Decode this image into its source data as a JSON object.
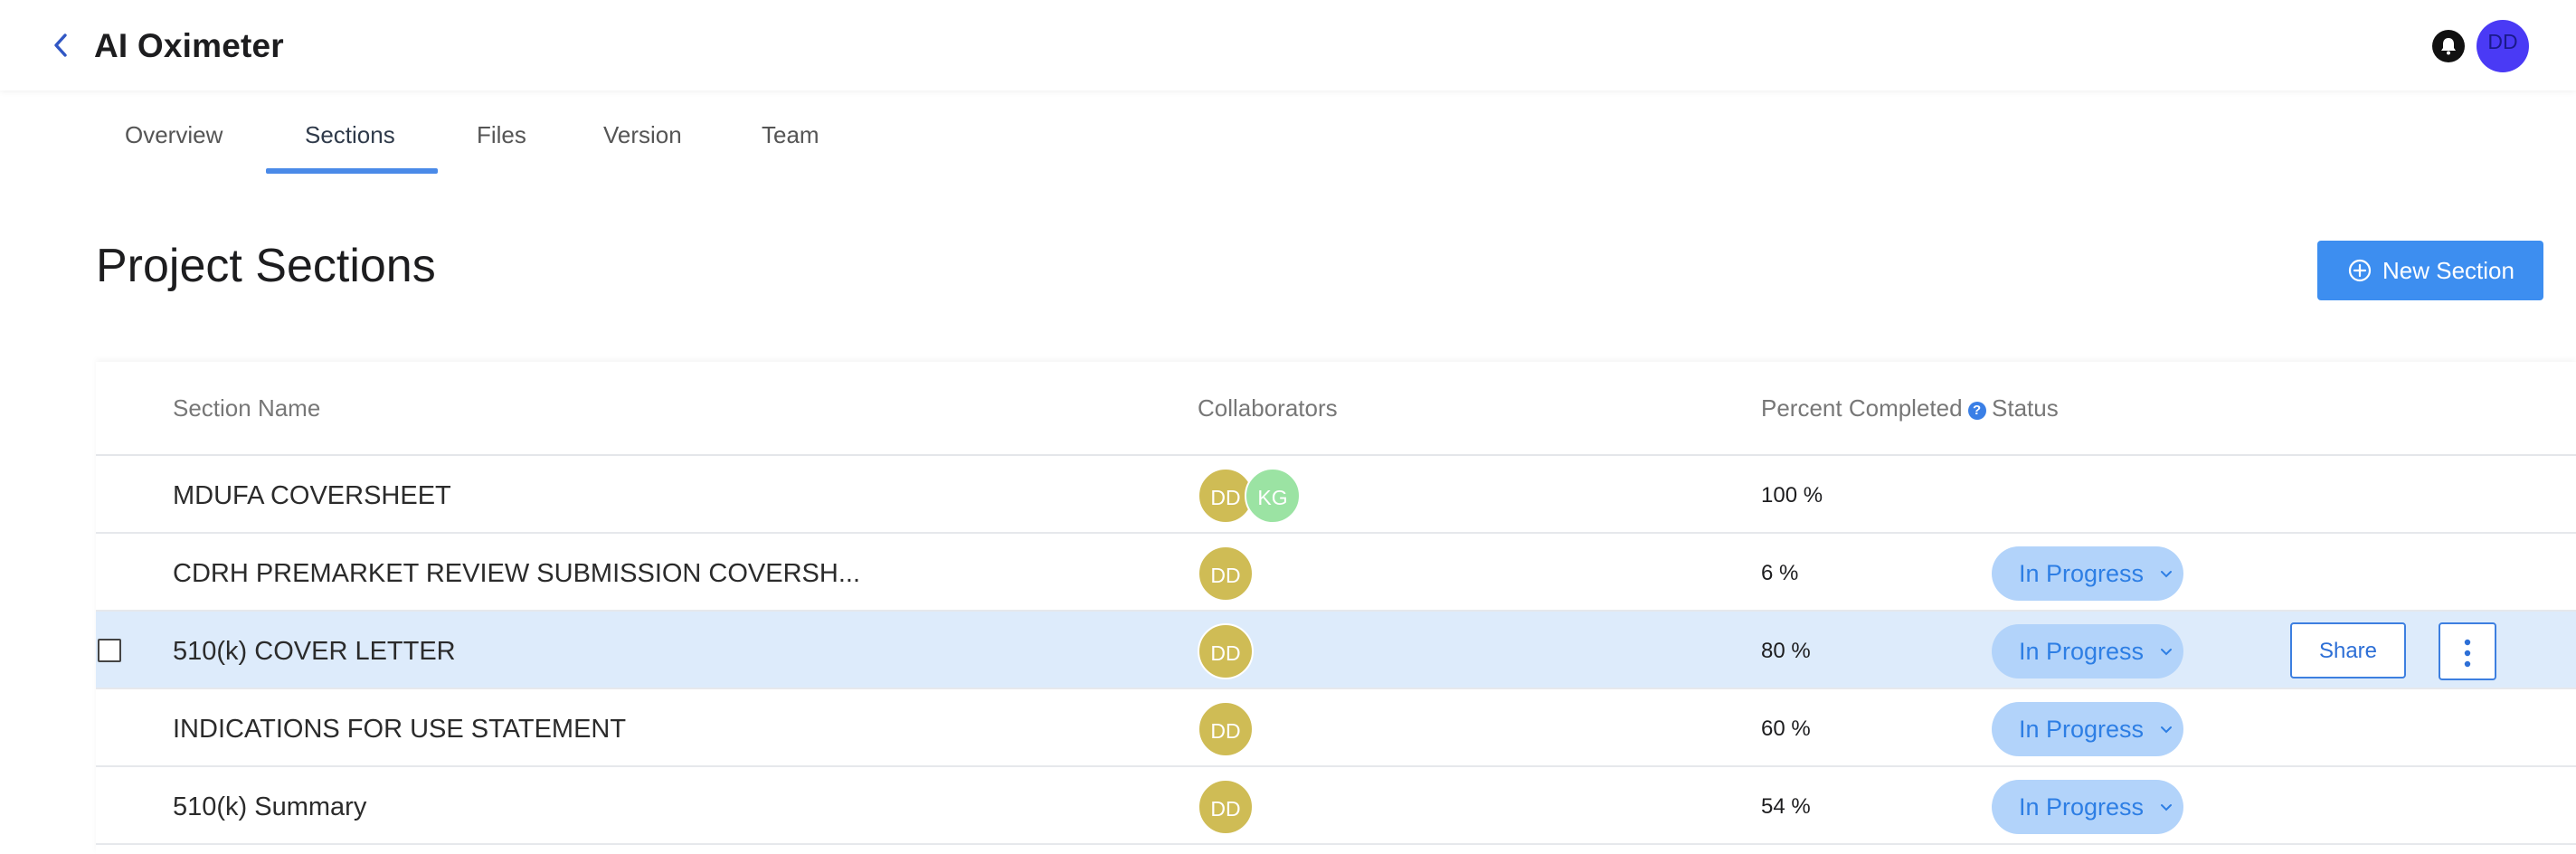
{
  "header": {
    "title": "AI Oximeter",
    "user_initials": "DD"
  },
  "tabs": [
    {
      "label": "Overview"
    },
    {
      "label": "Sections",
      "active": true
    },
    {
      "label": "Files"
    },
    {
      "label": "Version"
    },
    {
      "label": "Team"
    }
  ],
  "page": {
    "title": "Project Sections",
    "new_section_label": "New Section"
  },
  "table": {
    "columns": {
      "name": "Section Name",
      "collaborators": "Collaborators",
      "percent": "Percent Completed",
      "status": "Status"
    },
    "rows": [
      {
        "name": "MDUFA COVERSHEET",
        "collaborators": [
          "DD",
          "KG"
        ],
        "percent": "100 %",
        "status": ""
      },
      {
        "name": "CDRH PREMARKET REVIEW SUBMISSION COVERSH...",
        "collaborators": [
          "DD"
        ],
        "percent": "6 %",
        "status": "In Progress"
      },
      {
        "name": "510(k) COVER LETTER",
        "collaborators": [
          "DD"
        ],
        "percent": "80 %",
        "status": "In Progress",
        "selected": true,
        "share_label": "Share"
      },
      {
        "name": "INDICATIONS FOR USE STATEMENT",
        "collaborators": [
          "DD"
        ],
        "percent": "60 %",
        "status": "In Progress"
      },
      {
        "name": "510(k) Summary",
        "collaborators": [
          "DD"
        ],
        "percent": "54 %",
        "status": "In Progress"
      }
    ]
  },
  "colors": {
    "accent": "#3d8ef0",
    "tab_underline": "#4a8ae8",
    "selected_row": "#ddebfb",
    "status_pill_bg": "#b2d3fa",
    "status_pill_text": "#2d7ee4",
    "avatar_dd": "#cfbc55",
    "avatar_kg": "#9be3a3",
    "user_avatar": "#4a3af5"
  },
  "icons": {
    "back": "chevron-left-icon",
    "notifications": "bell-icon",
    "add": "plus-circle-icon",
    "help": "help-icon",
    "dropdown": "chevron-down-icon",
    "more": "more-vertical-icon"
  }
}
